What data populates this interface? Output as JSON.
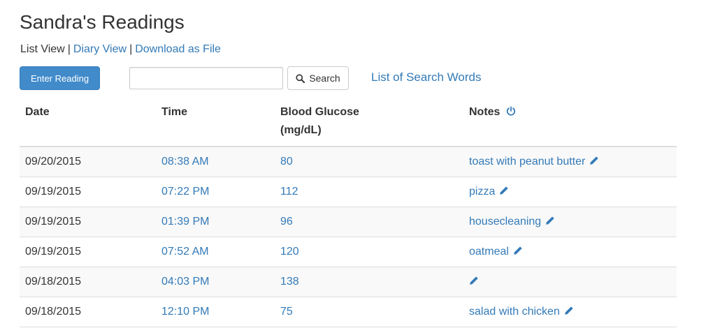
{
  "page": {
    "title": "Sandra's Readings"
  },
  "views": {
    "list_view": "List View",
    "separator": "|",
    "diary_view": "Diary View",
    "download": "Download as File"
  },
  "toolbar": {
    "enter_reading_label": "Enter Reading",
    "search_value": "",
    "search_placeholder": "",
    "search_button_label": "Search",
    "search_words_link": "List of Search Words"
  },
  "table": {
    "headers": {
      "date": "Date",
      "time": "Time",
      "glucose_line1": "Blood Glucose",
      "glucose_line2": "(mg/dL)",
      "notes": "Notes"
    },
    "rows": [
      {
        "date": "09/20/2015",
        "time": "08:38 AM",
        "glucose": "80",
        "note": "toast with peanut butter"
      },
      {
        "date": "09/19/2015",
        "time": "07:22 PM",
        "glucose": "112",
        "note": "pizza"
      },
      {
        "date": "09/19/2015",
        "time": "01:39 PM",
        "glucose": "96",
        "note": "housecleaning"
      },
      {
        "date": "09/19/2015",
        "time": "07:52 AM",
        "glucose": "120",
        "note": "oatmeal"
      },
      {
        "date": "09/18/2015",
        "time": "04:03 PM",
        "glucose": "138",
        "note": ""
      },
      {
        "date": "09/18/2015",
        "time": "12:10 PM",
        "glucose": "75",
        "note": "salad with chicken"
      }
    ]
  },
  "icons": {
    "search": "search-icon",
    "power": "power-icon",
    "edit": "pencil-icon"
  },
  "colors": {
    "link": "#337ab7",
    "primary_button": "#428bca",
    "stripe": "#f9f9f9",
    "border": "#dddddd"
  }
}
